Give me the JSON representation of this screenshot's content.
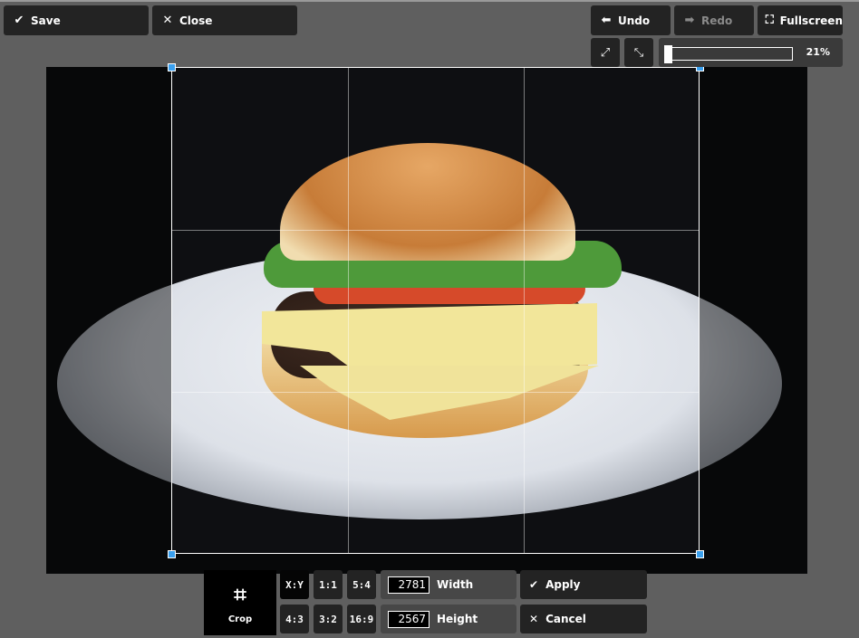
{
  "toolbar": {
    "save": "Save",
    "close": "Close",
    "undo": "Undo",
    "redo": "Redo",
    "fullscreen": "Fullscreen"
  },
  "zoom": {
    "value_percent": 21,
    "label": "21%"
  },
  "crop": {
    "label": "Crop",
    "ratios": [
      "X:Y",
      "1:1",
      "5:4",
      "4:3",
      "3:2",
      "16:9"
    ],
    "selected_ratio": "X:Y",
    "width_label": "Width",
    "width_value": "2781",
    "height_label": "Height",
    "height_value": "2567",
    "apply": "Apply",
    "cancel": "Cancel"
  },
  "colors": {
    "handle": "#3aa0ef",
    "button_bg": "#232323",
    "background": "#5f5f5f"
  }
}
